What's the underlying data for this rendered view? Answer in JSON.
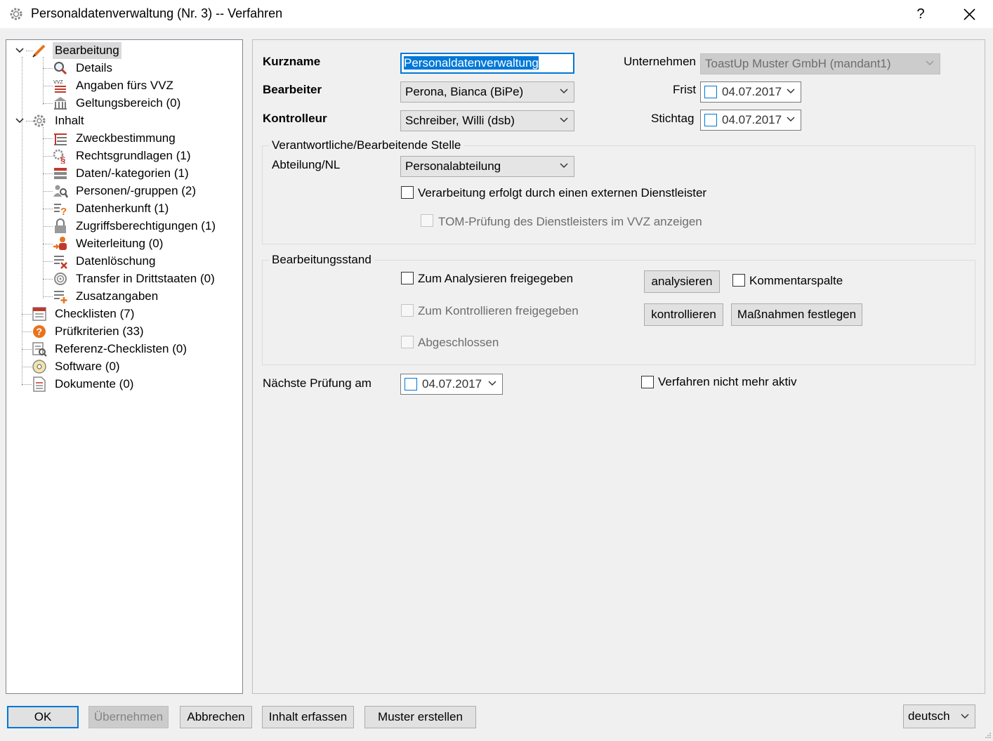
{
  "window": {
    "title": "Personaldatenverwaltung (Nr. 3) -- Verfahren",
    "help": "?"
  },
  "tree": {
    "items": [
      {
        "label": "Bearbeitung",
        "icon": "pencil-icon"
      },
      {
        "label": "Details",
        "icon": "magnifier-icon"
      },
      {
        "label": "Angaben fürs VVZ",
        "icon": "vvz-list-icon"
      },
      {
        "label": "Geltungsbereich (0)",
        "icon": "building-icon"
      },
      {
        "label": "Inhalt",
        "icon": "gear-icon"
      },
      {
        "label": "Zweckbestimmung",
        "icon": "list-icon"
      },
      {
        "label": "Rechtsgrundlagen (1)",
        "icon": "paragraph-gear-icon"
      },
      {
        "label": "Daten/-kategorien (1)",
        "icon": "data-stack-icon"
      },
      {
        "label": "Personen/-gruppen (2)",
        "icon": "people-search-icon"
      },
      {
        "label": "Datenherkunft (1)",
        "icon": "question-list-icon"
      },
      {
        "label": "Zugriffsberechtigungen (1)",
        "icon": "lock-icon"
      },
      {
        "label": "Weiterleitung (0)",
        "icon": "forward-person-icon"
      },
      {
        "label": "Datenlöschung",
        "icon": "delete-list-icon"
      },
      {
        "label": "Transfer in Drittstaaten (0)",
        "icon": "globe-icon"
      },
      {
        "label": "Zusatzangaben",
        "icon": "add-list-icon"
      },
      {
        "label": "Checklisten (7)",
        "icon": "checklist-icon"
      },
      {
        "label": "Prüfkriterien (33)",
        "icon": "question-badge-icon"
      },
      {
        "label": "Referenz-Checklisten (0)",
        "icon": "reference-checklist-icon"
      },
      {
        "label": "Software (0)",
        "icon": "cd-icon"
      },
      {
        "label": "Dokumente (0)",
        "icon": "document-icon"
      }
    ]
  },
  "form": {
    "kurzname_label": "Kurzname",
    "kurzname_value": "Personaldatenverwaltung",
    "bearbeiter_label": "Bearbeiter",
    "bearbeiter_value": "Perona, Bianca (BiPe)",
    "kontrolleur_label": "Kontrolleur",
    "kontrolleur_value": "Schreiber, Willi (dsb)",
    "unternehmen_label": "Unternehmen",
    "unternehmen_value": "ToastUp Muster GmbH (mandant1)",
    "frist_label": "Frist",
    "frist_value": "04.07.2017",
    "stichtag_label": "Stichtag",
    "stichtag_value": "04.07.2017"
  },
  "stelle": {
    "title": "Verantwortliche/Bearbeitende Stelle",
    "abteilung_label": "Abteilung/NL",
    "abteilung_value": "Personalabteilung",
    "extern_label": "Verarbeitung erfolgt durch einen externen Dienstleister",
    "tom_label": "TOM-Prüfung des Dienstleisters im VVZ anzeigen"
  },
  "stand": {
    "title": "Bearbeitungsstand",
    "analyse_label": "Zum Analysieren freigegeben",
    "kontrolle_label": "Zum Kontrollieren freigegeben",
    "abgeschlossen_label": "Abgeschlossen",
    "analysieren_btn": "analysieren",
    "kontrollieren_btn": "kontrollieren",
    "kommentar_label": "Kommentarspalte",
    "massnahmen_btn": "Maßnahmen festlegen"
  },
  "next": {
    "label": "Nächste Prüfung am",
    "value": "04.07.2017",
    "inactive_label": "Verfahren nicht mehr aktiv"
  },
  "footer": {
    "ok": "OK",
    "apply": "Übernehmen",
    "cancel": "Abbrechen",
    "content": "Inhalt erfassen",
    "template": "Muster erstellen",
    "language": "deutsch"
  }
}
